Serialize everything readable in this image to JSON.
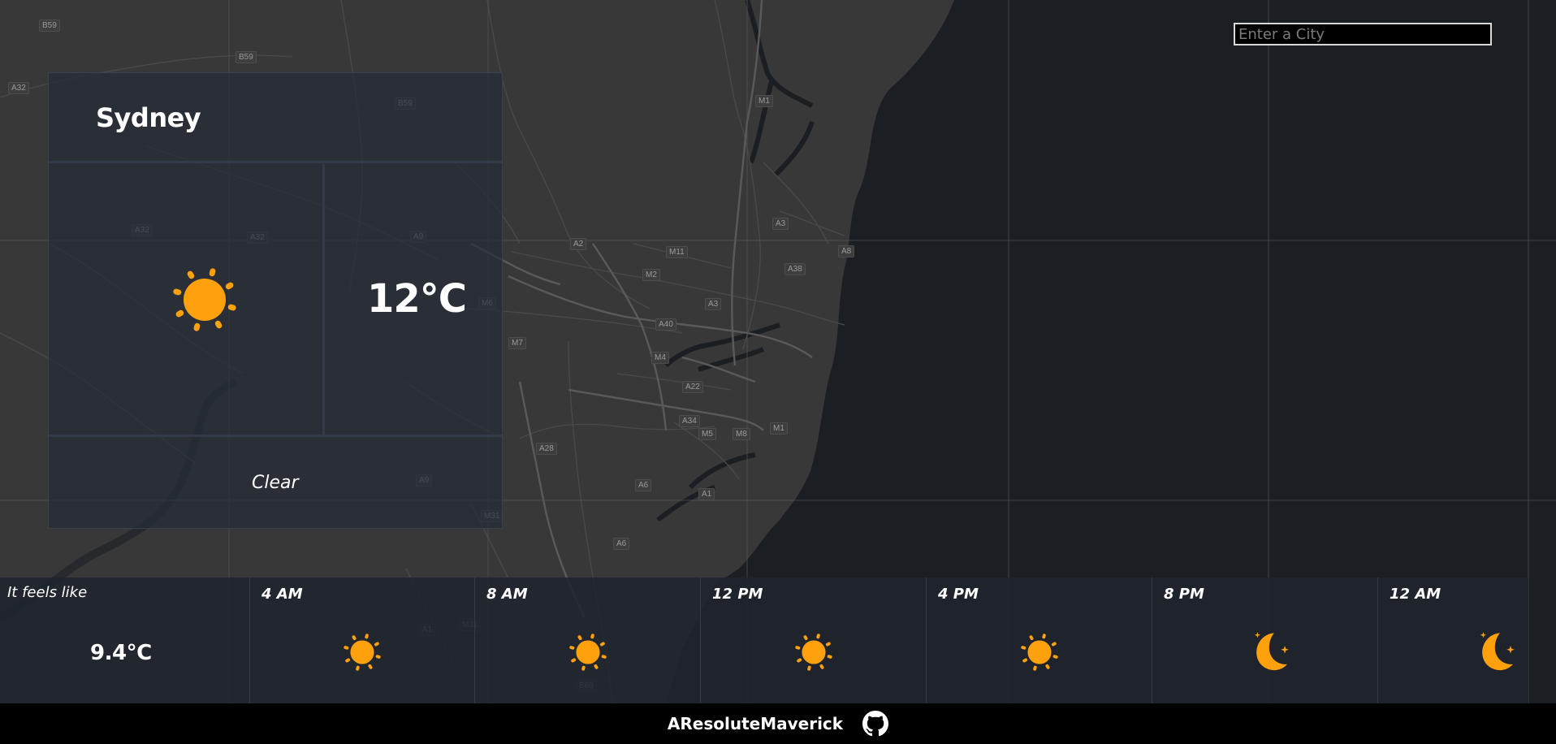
{
  "map": {
    "road_labels": [
      "B59",
      "B59",
      "A32",
      "B59",
      "A32",
      "A32",
      "A9",
      "M1",
      "A3",
      "A8",
      "A2",
      "M11",
      "M2",
      "A38",
      "A40",
      "A3",
      "M6",
      "M7",
      "M4",
      "A22",
      "A34",
      "M5",
      "M8",
      "M1",
      "A28",
      "A6",
      "A1",
      "A9",
      "M31",
      "A6",
      "A1",
      "M31",
      "B69",
      "M1"
    ]
  },
  "search": {
    "placeholder": "Enter a City",
    "value": ""
  },
  "current": {
    "city": "Sydney",
    "temperature": "12",
    "unit": "°C",
    "condition": "Clear",
    "icon": "sun-icon"
  },
  "feels_like": {
    "label": "It feels like",
    "value": "9.4",
    "unit": "°C"
  },
  "forecast": [
    {
      "time": "4 AM",
      "icon": "sun-icon"
    },
    {
      "time": "8 AM",
      "icon": "sun-icon"
    },
    {
      "time": "12 PM",
      "icon": "sun-icon"
    },
    {
      "time": "4 PM",
      "icon": "sun-icon"
    },
    {
      "time": "8 PM",
      "icon": "moon-icon"
    },
    {
      "time": "12 AM",
      "icon": "moon-icon"
    }
  ],
  "footer": {
    "name": "AResoluteMaverick",
    "icon": "github-icon"
  },
  "colors": {
    "accent": "#ffa10d",
    "map_land": "#383838",
    "map_sea": "#1b1f23",
    "card": "#262c38",
    "footer": "#000000"
  }
}
